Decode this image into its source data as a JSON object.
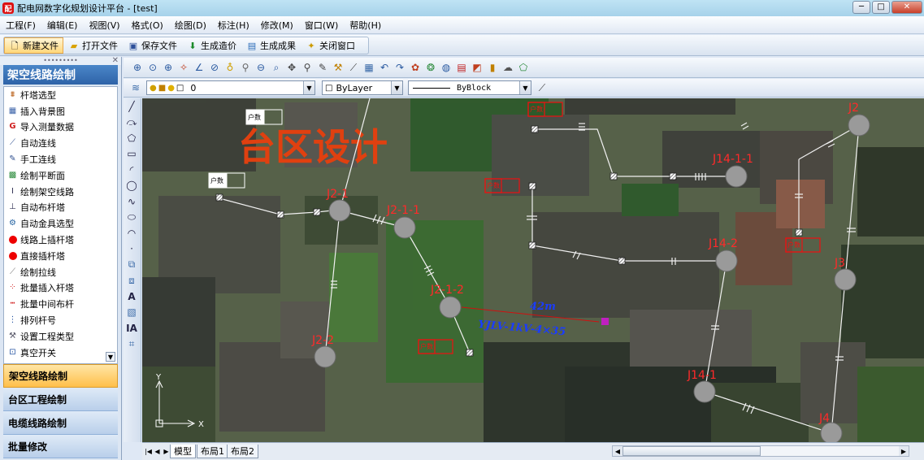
{
  "window": {
    "title": "配电网数字化规划设计平台 - [test]",
    "logo": "app-logo-icon"
  },
  "menu": [
    "工程(F)",
    "编辑(E)",
    "视图(V)",
    "格式(O)",
    "绘图(D)",
    "标注(H)",
    "修改(M)",
    "窗口(W)",
    "帮助(H)"
  ],
  "toolbar": {
    "new_file": "新建文件",
    "open_file": "打开文件",
    "save_file": "保存文件",
    "gen_cost": "生成造价",
    "gen_result": "生成成果",
    "close_window": "关闭窗口"
  },
  "left_panel": {
    "title": "架空线路绘制",
    "items": [
      {
        "label": "杆塔选型",
        "icon": "tower-icon"
      },
      {
        "label": "插入背景图",
        "icon": "image-icon"
      },
      {
        "label": "导入测量数据",
        "icon": "import-icon"
      },
      {
        "label": "自动连线",
        "icon": "auto-line-icon"
      },
      {
        "label": "手工连线",
        "icon": "manual-line-icon"
      },
      {
        "label": "绘制平断面",
        "icon": "profile-icon"
      },
      {
        "label": "绘制架空线路",
        "icon": "overhead-line-icon"
      },
      {
        "label": "自动布杆塔",
        "icon": "auto-tower-icon"
      },
      {
        "label": "自动金具选型",
        "icon": "fitting-icon"
      },
      {
        "label": "线路上插杆塔",
        "icon": "red-dot-icon"
      },
      {
        "label": "直接插杆塔",
        "icon": "red-dot-icon"
      },
      {
        "label": "绘制拉线",
        "icon": "stay-wire-icon"
      },
      {
        "label": "批量插入杆塔",
        "icon": "batch-insert-icon"
      },
      {
        "label": "批量中间布杆",
        "icon": "batch-middle-icon"
      },
      {
        "label": "排列杆号",
        "icon": "number-icon"
      },
      {
        "label": "设置工程类型",
        "icon": "settings-icon"
      },
      {
        "label": "真空开关",
        "icon": "switch-icon"
      }
    ],
    "sections": [
      "架空线路绘制",
      "台区工程绘制",
      "电缆线路绘制",
      "批量修改"
    ]
  },
  "layer_bar": {
    "layer": "0",
    "color": "ByLayer",
    "linetype": "ByBlock"
  },
  "canvas": {
    "big_label": "台区设计",
    "households": "户数",
    "dimension": "42m",
    "cable": "YJLV-1kV-4×35",
    "axis_x": "X",
    "axis_y": "Y",
    "poles": [
      "J2-1",
      "J2-1-1",
      "J2-1-2",
      "J2-2",
      "J14-1-1",
      "J2",
      "J14-2",
      "J3",
      "J14-1",
      "J4"
    ],
    "colors": {
      "pole": "#9a9a9a",
      "label": "#ff2a2a",
      "big_label": "#e04010",
      "cable_text": "#1a3cff",
      "line": "#f0f0f0"
    }
  },
  "layout_tabs": [
    "模型",
    "布局1",
    "布局2"
  ]
}
